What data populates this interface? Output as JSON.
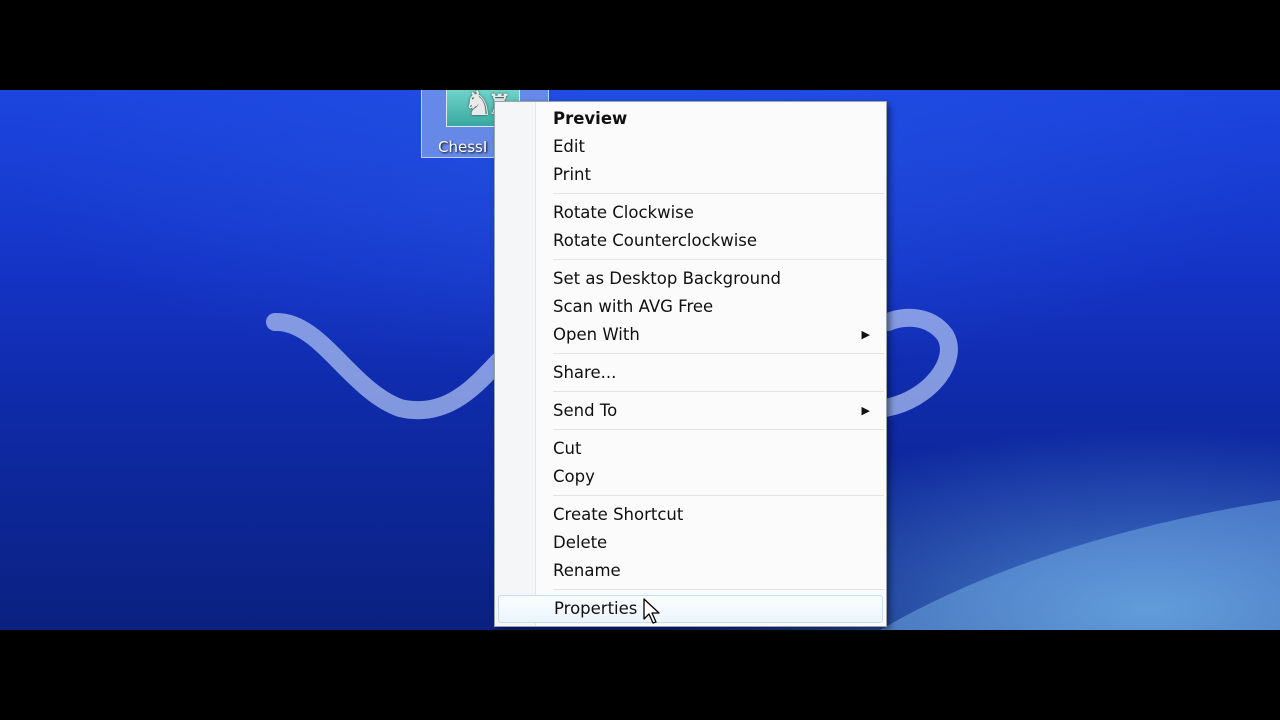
{
  "desktop": {
    "icon": {
      "label": "ChessI",
      "icon_name": "image-file-icon"
    }
  },
  "context_menu": {
    "groups": [
      [
        {
          "label": "Preview",
          "bold": true
        },
        {
          "label": "Edit"
        },
        {
          "label": "Print"
        }
      ],
      [
        {
          "label": "Rotate Clockwise"
        },
        {
          "label": "Rotate Counterclockwise"
        }
      ],
      [
        {
          "label": "Set as Desktop Background"
        },
        {
          "label": "Scan with AVG Free"
        },
        {
          "label": "Open With",
          "submenu": true
        }
      ],
      [
        {
          "label": "Share..."
        }
      ],
      [
        {
          "label": "Send To",
          "submenu": true
        }
      ],
      [
        {
          "label": "Cut"
        },
        {
          "label": "Copy"
        }
      ],
      [
        {
          "label": "Create Shortcut"
        },
        {
          "label": "Delete"
        },
        {
          "label": "Rename"
        }
      ],
      [
        {
          "label": "Properties",
          "hover": true
        }
      ]
    ],
    "submenu_arrow": "▶"
  },
  "colors": {
    "desktop_blue": "#1433c4",
    "menu_background": "#fbfbfb",
    "hover_border": "#c3def5"
  }
}
